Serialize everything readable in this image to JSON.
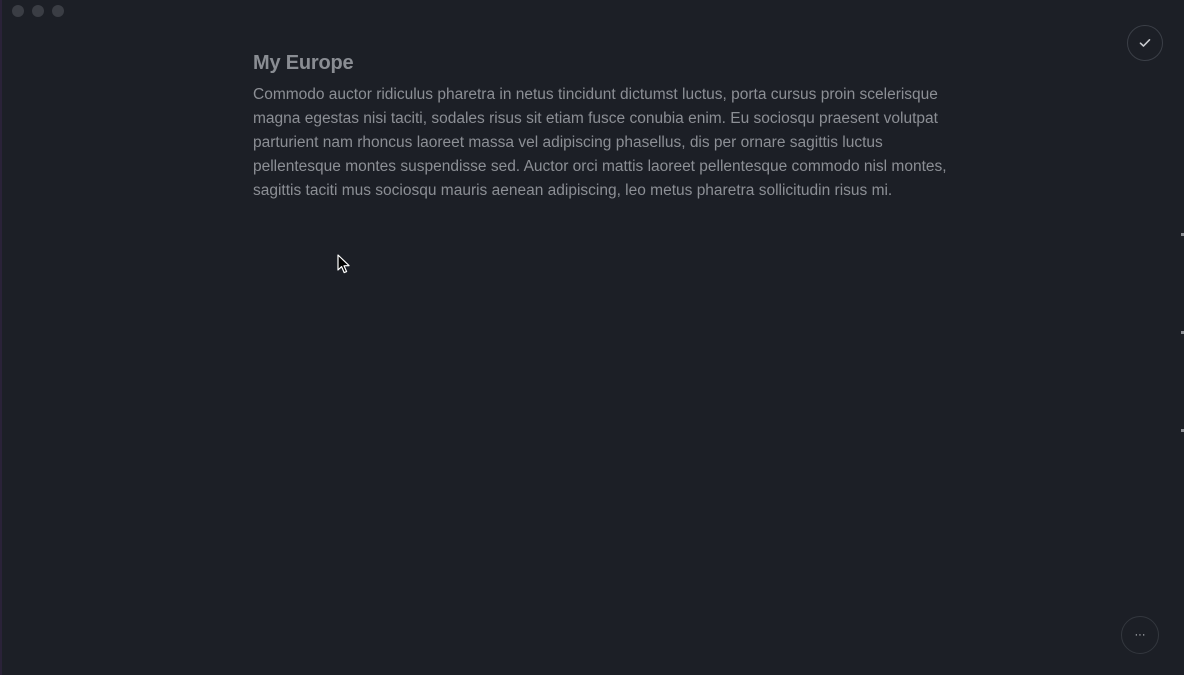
{
  "window": {
    "traffic_lights": [
      "close",
      "minimize",
      "zoom"
    ]
  },
  "toolbar": {
    "done_icon": "checkmark-icon",
    "more_icon": "ellipsis-icon",
    "more_label": "···"
  },
  "note": {
    "title": "My Europe",
    "body": "Commodo auctor ridiculus pharetra in netus tincidunt dictumst luctus, porta cursus proin scelerisque magna egestas nisi taciti, sodales risus sit etiam fusce conubia enim. Eu sociosqu praesent volutpat parturient nam rhoncus laoreet massa vel adipiscing phasellus, dis per ornare sagittis luctus pellentesque montes suspendisse sed. Auctor orci mattis laoreet pellentesque commodo nisl montes, sagittis taciti mus sociosqu mauris aenean adipiscing, leo metus pharetra sollicitudin risus mi."
  },
  "colors": {
    "background": "#1c1f26",
    "text": "#8c8f95",
    "button_border": "#3b3f47"
  }
}
